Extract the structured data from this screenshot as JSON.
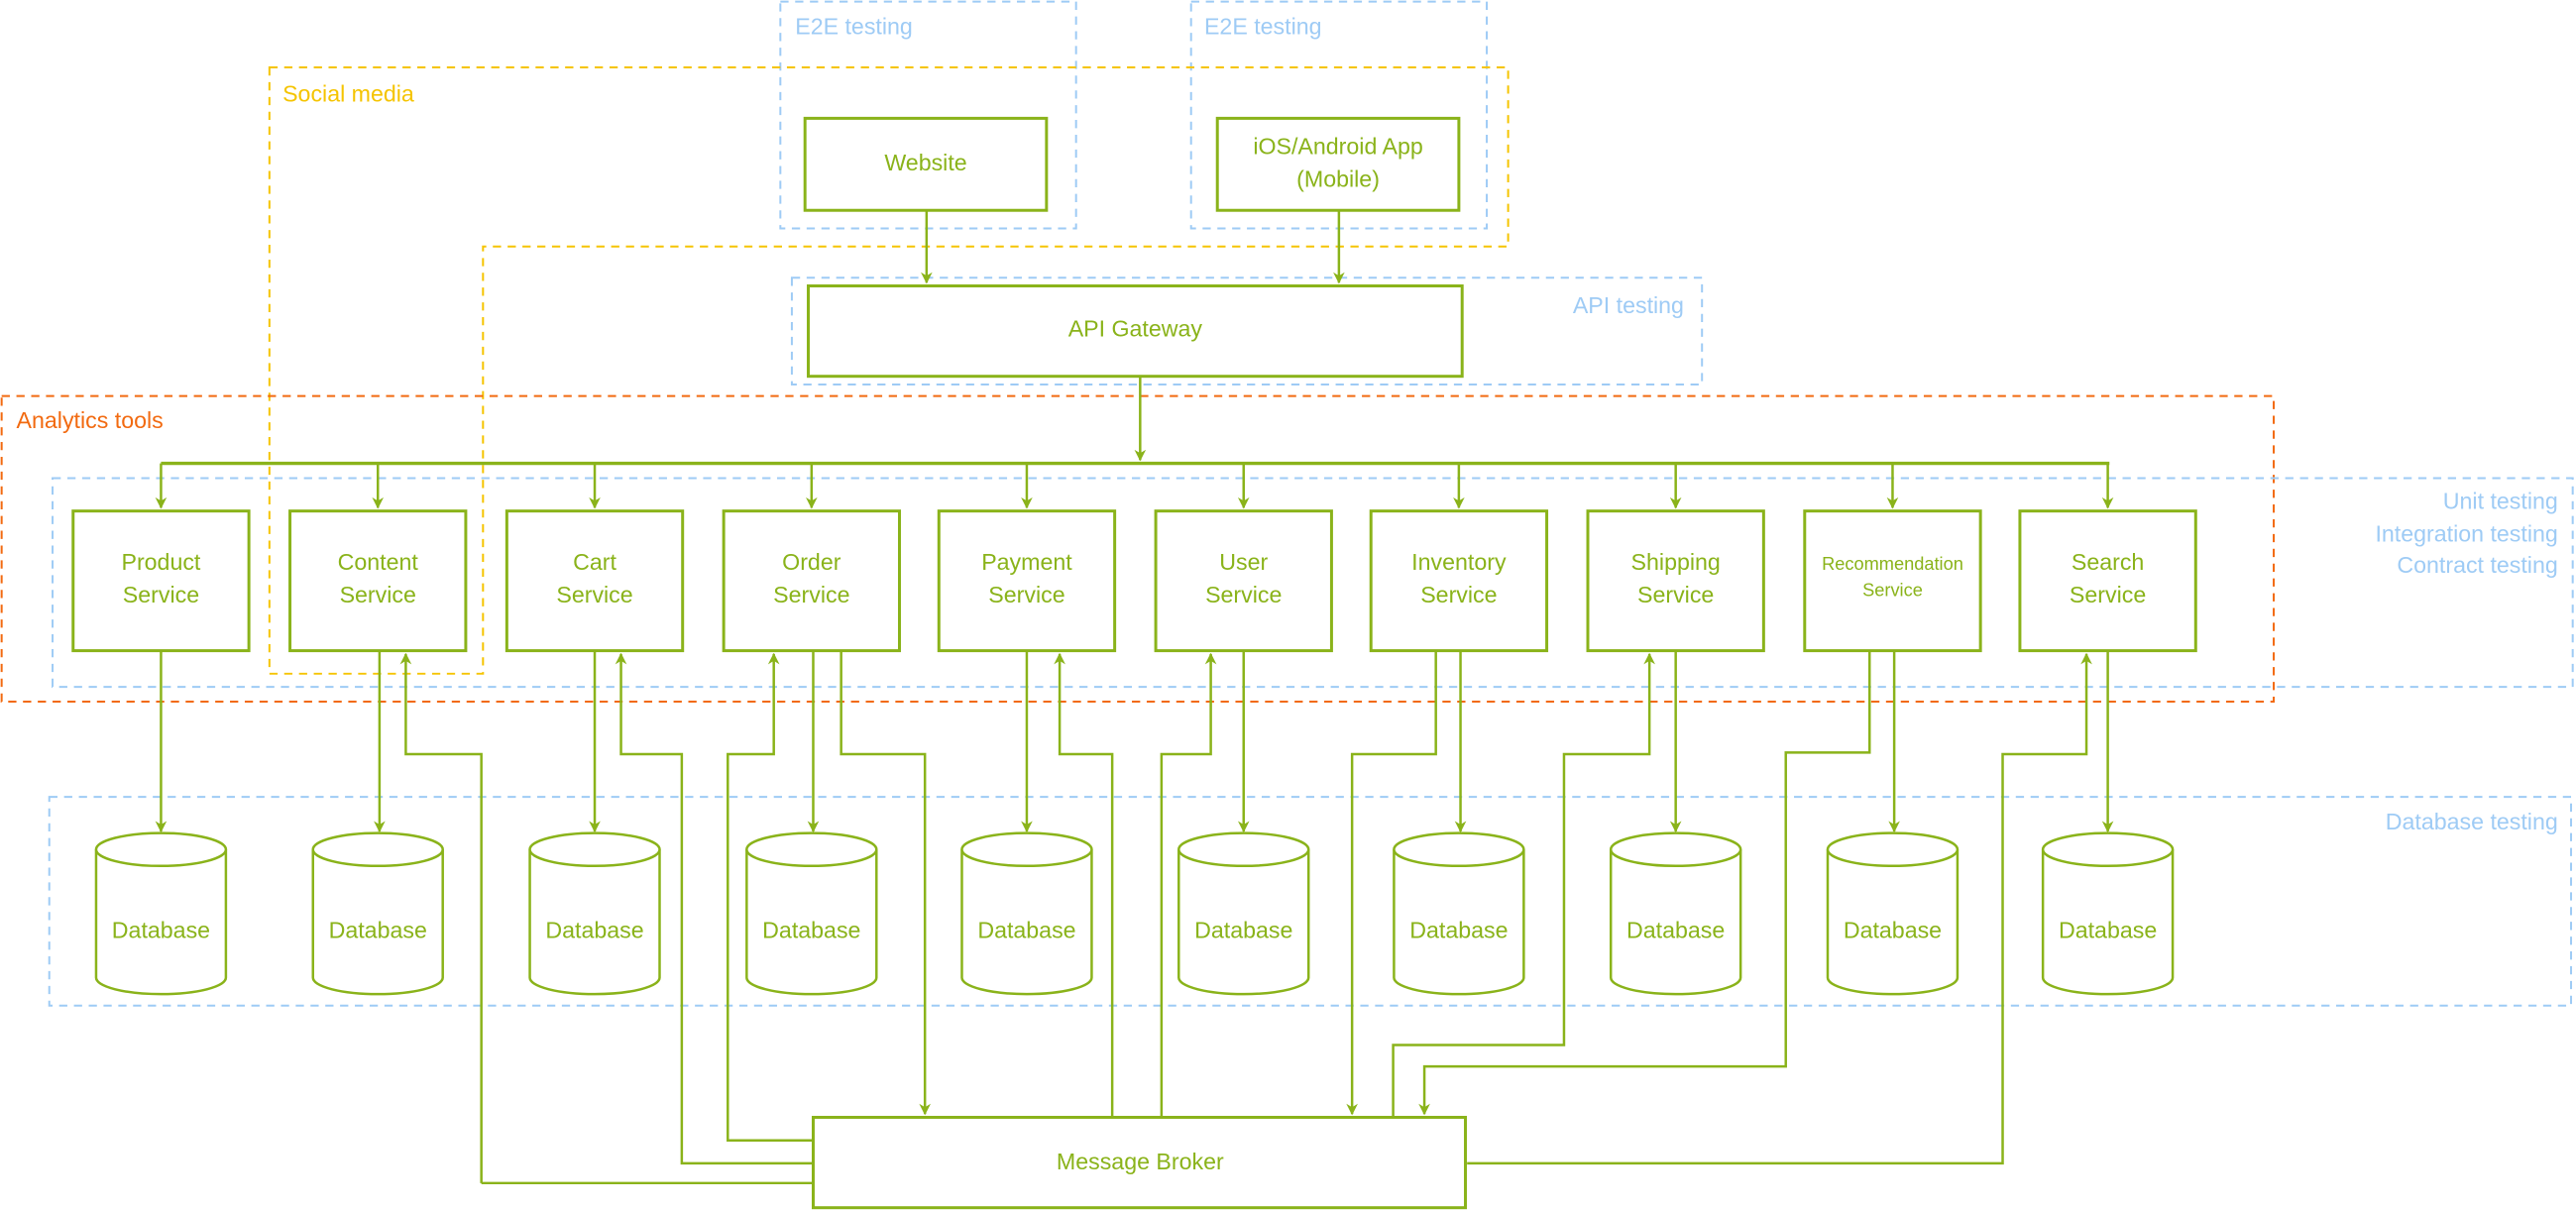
{
  "colors": {
    "node": "#8ab31a",
    "e2e": "#9ecbf5",
    "social": "#f5c400",
    "analytics": "#f26a10",
    "testing": "#9ecbf5"
  },
  "zones": {
    "e2e_web": "E2E testing",
    "e2e_mobile": "E2E testing",
    "social_media": "Social media",
    "api_testing": "API testing",
    "analytics_tools": "Analytics tools",
    "unit_testing": "Unit testing",
    "integration_testing": "Integration testing",
    "contract_testing": "Contract testing",
    "database_testing": "Database testing"
  },
  "clients": {
    "website": [
      "Website"
    ],
    "mobile": [
      "iOS/Android App",
      "(Mobile)"
    ]
  },
  "gateway": "API Gateway",
  "broker": "Message Broker",
  "services": [
    {
      "id": "product",
      "lines": [
        "Product",
        "Service"
      ]
    },
    {
      "id": "content",
      "lines": [
        "Content",
        "Service"
      ]
    },
    {
      "id": "cart",
      "lines": [
        "Cart",
        "Service"
      ]
    },
    {
      "id": "order",
      "lines": [
        "Order",
        "Service"
      ]
    },
    {
      "id": "payment",
      "lines": [
        "Payment",
        "Service"
      ]
    },
    {
      "id": "user",
      "lines": [
        "User",
        "Service"
      ]
    },
    {
      "id": "inventory",
      "lines": [
        "Inventory",
        "Service"
      ]
    },
    {
      "id": "shipping",
      "lines": [
        "Shipping",
        "Service"
      ]
    },
    {
      "id": "recommendation",
      "lines": [
        "Recommendation",
        "Service"
      ],
      "small": true
    },
    {
      "id": "search",
      "lines": [
        "Search",
        "Service"
      ]
    }
  ],
  "database_label": "Database",
  "broker_links": [
    {
      "service": "content",
      "direction": "to-service"
    },
    {
      "service": "cart",
      "direction": "to-service"
    },
    {
      "service": "order",
      "direction": "to-service"
    },
    {
      "service": "order",
      "direction": "to-broker"
    },
    {
      "service": "payment",
      "direction": "to-service"
    },
    {
      "service": "user",
      "direction": "to-service"
    },
    {
      "service": "inventory",
      "direction": "to-broker"
    },
    {
      "service": "shipping",
      "direction": "to-service"
    },
    {
      "service": "recommendation",
      "direction": "to-broker"
    },
    {
      "service": "search",
      "direction": "to-service"
    }
  ]
}
